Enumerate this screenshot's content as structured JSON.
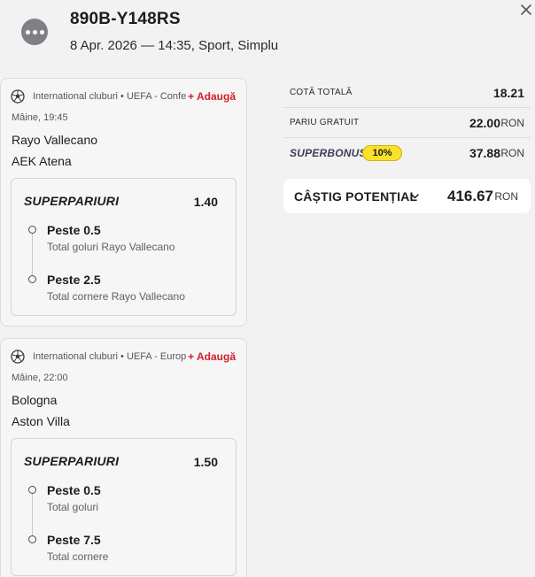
{
  "header": {
    "ticket_id": "890B-Y148RS",
    "meta": "8 Apr. 2026 — 14:35, Sport, Simplu",
    "menu_icon": "more-horizontal-icon",
    "close_icon": "close-icon"
  },
  "events": [
    {
      "league": "International cluburi • UEFA - Conference League",
      "add_label": "+ Adaugă",
      "time": "Mâine, 19:45",
      "home": "Rayo Vallecano",
      "away": "AEK Atena",
      "superpariuri_label": "SUPERPARIURI",
      "odd": "1.40",
      "selections": [
        {
          "name": "Peste 0.5",
          "market": "Total goluri Rayo Vallecano"
        },
        {
          "name": "Peste 2.5",
          "market": "Total cornere Rayo Vallecano"
        }
      ]
    },
    {
      "league": "International cluburi • UEFA - Europa League",
      "add_label": "+ Adaugă",
      "time": "Mâine, 22:00",
      "home": "Bologna",
      "away": "Aston Villa",
      "superpariuri_label": "SUPERPARIURI",
      "odd": "1.50",
      "selections": [
        {
          "name": "Peste 0.5",
          "market": "Total goluri"
        },
        {
          "name": "Peste 7.5",
          "market": "Total cornere"
        }
      ]
    }
  ],
  "summary": {
    "total_odds_label": "COTĂ TOTALĂ",
    "total_odds": "18.21",
    "free_bet_label": "PARIU GRATUIT",
    "free_bet": "22.00",
    "currency": "RON",
    "superbonus_label": "SUPERBONUS",
    "superbonus_pct": "10%",
    "superbonus_value": "37.88"
  },
  "payout": {
    "label": "CÂȘTIG POTENȚIAL",
    "value": "416.67",
    "currency": "RON"
  },
  "colors": {
    "accent_red": "#d0202a",
    "badge_yellow": "#fbe12d",
    "background": "#f2f2f3"
  }
}
